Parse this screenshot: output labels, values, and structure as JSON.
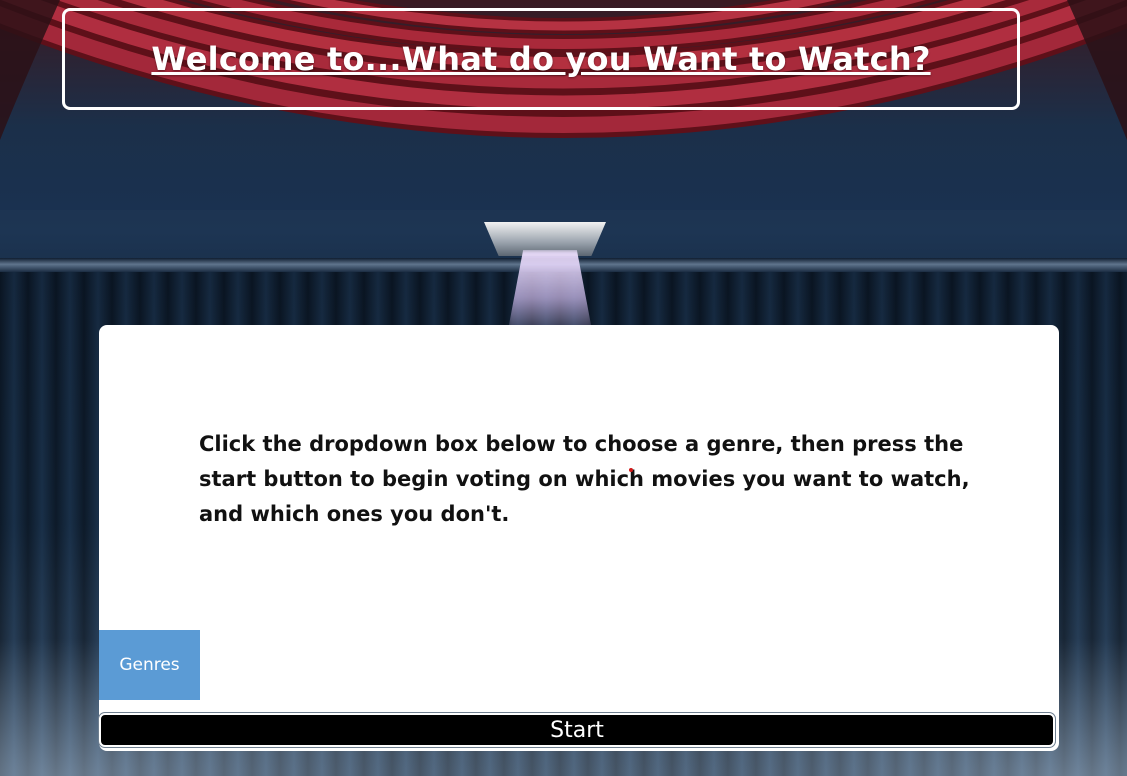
{
  "header": {
    "title": "Welcome to...What do you Want to Watch?"
  },
  "main": {
    "instructions": "Click the dropdown box below to choose a genre, then press the start button to begin voting on which movies you want to watch, and which ones you don't.",
    "genres_label": "Genres",
    "start_label": "Start"
  },
  "colors": {
    "curtain_red": "#9e2430",
    "genres_button": "#5b9bd5",
    "start_button": "#000000",
    "card": "#ffffff"
  },
  "icons": {
    "spotlight": "spotlight-icon"
  }
}
